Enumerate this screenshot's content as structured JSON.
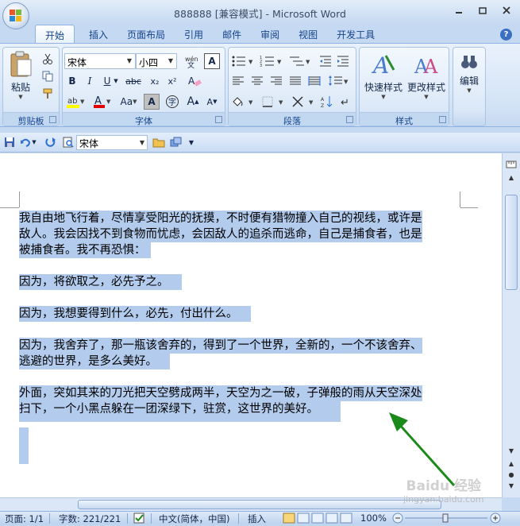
{
  "window": {
    "title": "888888 [兼容模式] - Microsoft Word"
  },
  "tabs": [
    "开始",
    "插入",
    "页面布局",
    "引用",
    "邮件",
    "审阅",
    "视图",
    "开发工具"
  ],
  "ribbon": {
    "clipboard": {
      "paste_label": "粘贴",
      "group_label": "剪贴板"
    },
    "font": {
      "font_name": "宋体",
      "font_size": "小四",
      "group_label": "字体",
      "bold": "B",
      "italic": "I",
      "underline": "U",
      "strike": "abc",
      "subscript": "x₂",
      "superscript": "x²",
      "case": "Aa",
      "grow": "A",
      "shrink": "A"
    },
    "paragraph": {
      "group_label": "段落"
    },
    "styles": {
      "quick_styles": "快速样式",
      "change_styles": "更改样式",
      "group_label": "样式"
    },
    "editing": {
      "label": "编辑"
    }
  },
  "qat": {
    "font_name": "宋体"
  },
  "document": {
    "paragraphs": [
      [
        "我自由地飞行着，尽情享受阳光的抚摸，不时便有猎物撞入自己的视线，或许是",
        "敌人。我会因找不到食物而忧虑，会因敌人的追杀而逃命，自己是捕食者，也是",
        "被捕食者。我不再恐惧："
      ],
      [
        "因为，将欲取之，必先予之。"
      ],
      [
        "因为，我想要得到什么，必先，付出什么。"
      ],
      [
        "因为，我舍弃了，那一瓶该舍弃的，得到了一个世界，全新的，一个不该舍弃、",
        "逃避的世界，是多么美好。"
      ],
      [
        "外面，突如其来的刀光把天空劈成两半，天空为之一破，子弹般的雨从天空深处",
        "扫下，一个小黑点躲在一团深绿下，驻赏，这世界的美好。"
      ]
    ]
  },
  "statusbar": {
    "page": "页面: 1/1",
    "words": "字数: 221/221",
    "language": "中文(简体，中国)",
    "mode": "插入",
    "zoom": "100%"
  },
  "watermark": {
    "line1": "Baidu 经验",
    "line2": "jingyan.baidu.com"
  },
  "colors": {
    "selection": "#b3ccee",
    "arrow": "#1a8a1a",
    "ribbon": "#d3e3f6"
  }
}
